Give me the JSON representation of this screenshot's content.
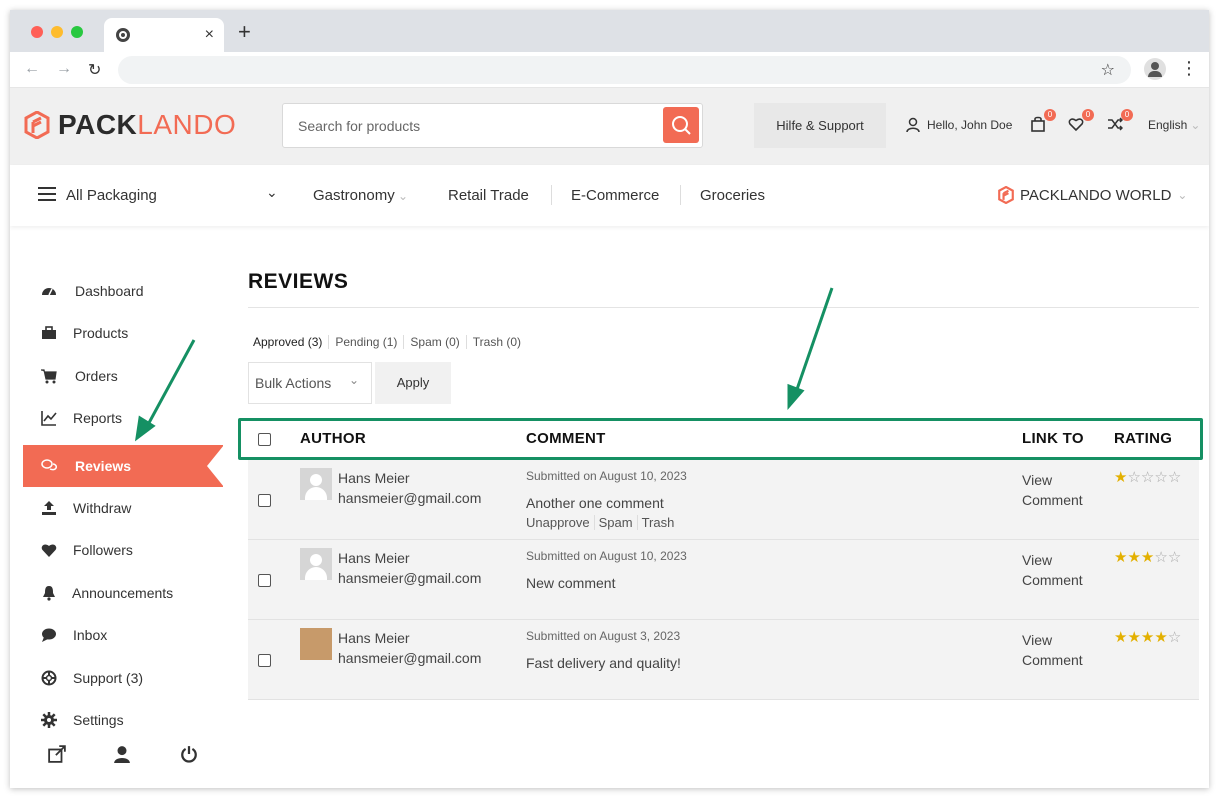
{
  "browser": {
    "new_tab": "+",
    "tab_close": "×"
  },
  "header": {
    "logo_part1": "PACK",
    "logo_part2": "LANDO",
    "search_placeholder": "Search for products",
    "help_label": "Hilfe & Support",
    "greeting": "Hello, John Doe",
    "cart_count": "0",
    "wishlist_count": "0",
    "compare_count": "0",
    "language": "English",
    "brand_color": "#f26b54"
  },
  "catnav": {
    "all_label": "All Packaging",
    "categories": [
      "Gastronomy",
      "Retail Trade",
      "E-Commerce",
      "Groceries"
    ],
    "world_label": "PACKLANDO WORLD"
  },
  "sidebar": {
    "items": [
      {
        "label": "Dashboard",
        "icon": "gauge-icon"
      },
      {
        "label": "Products",
        "icon": "briefcase-icon"
      },
      {
        "label": "Orders",
        "icon": "cart-icon"
      },
      {
        "label": "Reports",
        "icon": "chart-icon"
      },
      {
        "label": "Reviews",
        "icon": "comments-icon"
      },
      {
        "label": "Withdraw",
        "icon": "upload-icon"
      },
      {
        "label": "Followers",
        "icon": "heart-icon"
      },
      {
        "label": "Announcements",
        "icon": "bell-icon"
      },
      {
        "label": "Inbox",
        "icon": "chat-icon"
      },
      {
        "label": "Support (3)",
        "icon": "lifebuoy-icon"
      },
      {
        "label": "Settings",
        "icon": "gear-icon"
      }
    ],
    "active_index": 4
  },
  "main": {
    "title": "REVIEWS",
    "filters": [
      "Approved (3)",
      "Pending (1)",
      "Spam (0)",
      "Trash (0)"
    ],
    "bulk_actions": "Bulk Actions",
    "apply": "Apply",
    "columns": {
      "author": "AUTHOR",
      "comment": "COMMENT",
      "link_to": "LINK TO",
      "rating": "RATING"
    },
    "rows": [
      {
        "name": "Hans Meier",
        "email": "hansmeier@gmail.com",
        "submitted": "Submitted on August 10, 2023",
        "comment": "Another one comment",
        "actions": [
          "Unapprove",
          "Spam",
          "Trash"
        ],
        "link_line1": "View",
        "link_line2": "Comment",
        "rating": 1
      },
      {
        "name": "Hans Meier",
        "email": "hansmeier@gmail.com",
        "submitted": "Submitted on August 10, 2023",
        "comment": "New comment",
        "actions": [],
        "link_line1": "View",
        "link_line2": "Comment",
        "rating": 3
      },
      {
        "name": "Hans Meier",
        "email": "hansmeier@gmail.com",
        "submitted": "Submitted on August 3, 2023",
        "comment": "Fast delivery and quality!",
        "actions": [],
        "link_line1": "View",
        "link_line2": "Comment",
        "rating": 4
      }
    ]
  }
}
